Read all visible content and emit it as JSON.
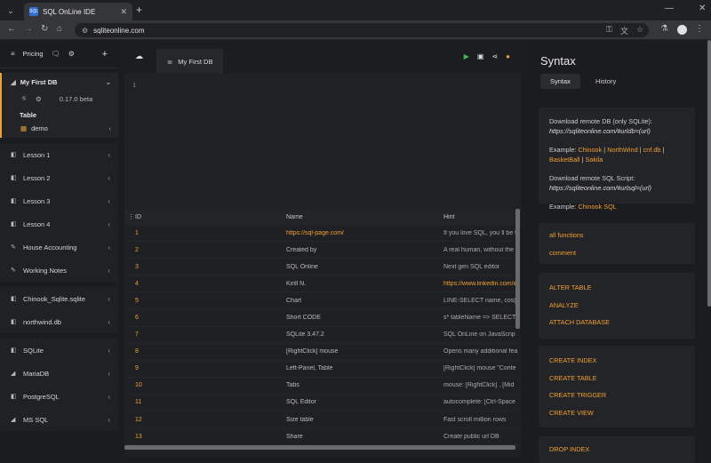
{
  "browser": {
    "tab_title": "SQL OnLine IDE",
    "favicon_text": "SQL",
    "url": "sqliteonline.com"
  },
  "sidebar": {
    "top": {
      "pricing": "Pricing"
    },
    "db": {
      "name": "My First DB",
      "version": "0.17.0 beta",
      "table_header": "Table",
      "tables": [
        "demo"
      ]
    },
    "lessons": [
      "Lesson 1",
      "Lesson 2",
      "Lesson 3",
      "Lesson 4",
      "House Accounting",
      "Working Notes"
    ],
    "files": [
      "Chinook_Sqlite.sqlite",
      "northwind.db"
    ],
    "engines": [
      "SQLite",
      "MariaDB",
      "PostgreSQL",
      "MS SQL"
    ]
  },
  "main": {
    "tab": "My First DB",
    "line_number": "1",
    "columns": [
      "ID",
      "Name",
      "Hint"
    ],
    "rows": [
      {
        "id": "1",
        "name": "https://sql-page.com/",
        "hint": "If you love SQL, you`ll be t",
        "link": true
      },
      {
        "id": "2",
        "name": "Created by",
        "hint": "A real human, without the"
      },
      {
        "id": "3",
        "name": "SQL Online",
        "hint": "Next gen SQL editor"
      },
      {
        "id": "4",
        "name": "Kirill N.",
        "hint": "https://www.linkedin.com/in",
        "hint_link": true
      },
      {
        "id": "5",
        "name": "Chart",
        "hint": "LINE-SELECT name, cos("
      },
      {
        "id": "6",
        "name": "Short CODE",
        "hint": "s* tableName => SELECT"
      },
      {
        "id": "7",
        "name": "SQLite 3.47.2",
        "hint": "SQL OnLine on JavaScrip"
      },
      {
        "id": "8",
        "name": "[RightClick] mouse",
        "hint": "Opens many additional fea"
      },
      {
        "id": "9",
        "name": "Left-Panel, Table",
        "hint": "[RightClick] mouse \"Conte"
      },
      {
        "id": "10",
        "name": "Tabs",
        "hint": "mouse: [RightClick] , [Mid"
      },
      {
        "id": "11",
        "name": "SQL Editor",
        "hint": "autocomplete: [Ctrl-Space"
      },
      {
        "id": "12",
        "name": "Size table",
        "hint": "Fast scroll million rows"
      },
      {
        "id": "13",
        "name": "Share",
        "hint": "Create public url DB"
      }
    ]
  },
  "syntax": {
    "title": "Syntax",
    "tabs": [
      "Syntax",
      "History"
    ],
    "remote_db_label": "Download remote DB (only SQLite):",
    "remote_db_url": "https://sqliteonline.com/#urldb=(url)",
    "example_label": "Example:",
    "examples": [
      "Chinook",
      "NorthWind",
      "cnf.db",
      "BasketBall",
      "Sakila"
    ],
    "remote_sql_label": "Download remote SQL Script:",
    "remote_sql_url": "https://sqliteonline.com/#urlsql=(url)",
    "sql_example": "Chinook SQL",
    "group1": [
      "all functions",
      "comment"
    ],
    "group2": [
      "ALTER TABLE",
      "ANALYZE",
      "ATTACH DATABASE"
    ],
    "group3": [
      "CREATE INDEX",
      "CREATE TABLE",
      "CREATE TRIGGER",
      "CREATE VIEW"
    ],
    "group4": [
      "DROP INDEX"
    ]
  }
}
